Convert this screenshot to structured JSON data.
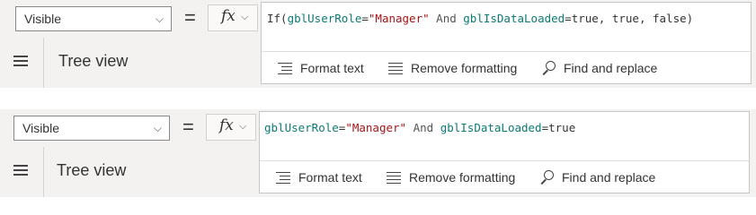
{
  "panels": [
    {
      "property_select": {
        "value": "Visible"
      },
      "equals": "=",
      "fx_label": "fx",
      "formula": {
        "t1": "If(",
        "t2": "gblUserRole",
        "t3": "=",
        "t4": "\"Manager\"",
        "t5": " And ",
        "t6": "gblIsDataLoaded",
        "t7": "=true, true, false)"
      },
      "toolbar": {
        "format_text": "Format text",
        "remove_formatting": "Remove formatting",
        "find_replace": "Find and replace"
      },
      "tree_view_label": "Tree view"
    },
    {
      "property_select": {
        "value": "Visible"
      },
      "equals": "=",
      "fx_label": "fx",
      "formula": {
        "t1": "",
        "t2": "gblUserRole",
        "t3": "=",
        "t4": "\"Manager\"",
        "t5": " And ",
        "t6": "gblIsDataLoaded",
        "t7": "=true"
      },
      "toolbar": {
        "format_text": "Format text",
        "remove_formatting": "Remove formatting",
        "find_replace": "Find and replace"
      },
      "tree_view_label": "Tree view"
    }
  ],
  "colors": {
    "string_literal": "#a31515",
    "variable": "#0b7a75",
    "bar_background": "#f3f2f1"
  },
  "icons": [
    "hamburger-icon",
    "chevron-down-icon",
    "fx-icon",
    "format-text-icon",
    "remove-formatting-icon",
    "search-icon"
  ]
}
